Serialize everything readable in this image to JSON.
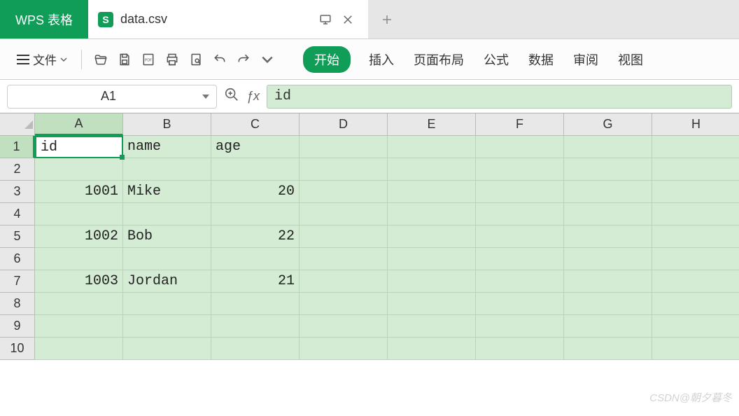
{
  "app": {
    "brand_label": "WPS 表格",
    "file_tab_name": "data.csv"
  },
  "toolbar": {
    "file_menu_label": "文件"
  },
  "ribbon": {
    "tabs": [
      "开始",
      "插入",
      "页面布局",
      "公式",
      "数据",
      "审阅",
      "视图"
    ],
    "active_index": 0
  },
  "namebox": {
    "value": "A1"
  },
  "formula": {
    "value": "id"
  },
  "sheet": {
    "columns": [
      "A",
      "B",
      "C",
      "D",
      "E",
      "F",
      "G",
      "H"
    ],
    "row_count": 10,
    "selected_cell": "A1",
    "data": {
      "1": {
        "A": "id",
        "B": "name",
        "C": "age"
      },
      "3": {
        "A": "1001",
        "B": "Mike",
        "C": "20"
      },
      "5": {
        "A": "1002",
        "B": "Bob",
        "C": "22"
      },
      "7": {
        "A": "1003",
        "B": "Jordan",
        "C": "21"
      }
    },
    "numeric_columns": {
      "A": [
        3,
        5,
        7
      ],
      "C": [
        3,
        5,
        7
      ]
    }
  },
  "watermark": "CSDN@朝夕暮冬"
}
